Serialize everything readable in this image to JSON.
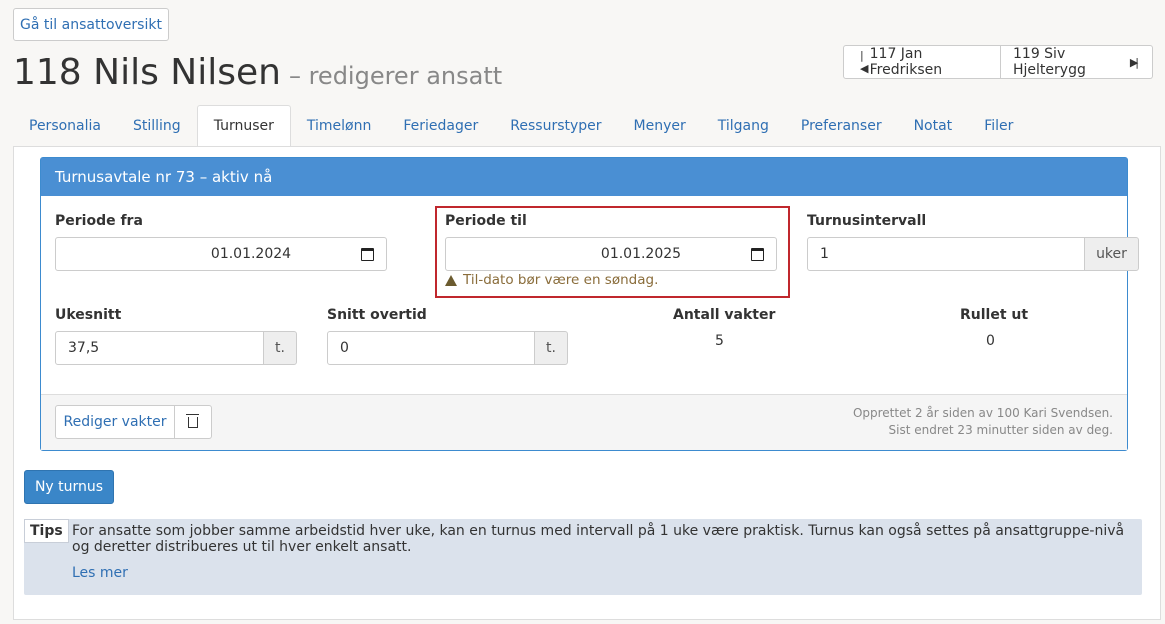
{
  "top_button": "Gå til ansattoversikt",
  "title": {
    "main": "118 Nils Nilsen",
    "sub": "– redigerer ansatt"
  },
  "nav": {
    "prev": "117 Jan Fredriksen",
    "next": "119 Siv Hjelterygg"
  },
  "tabs": [
    "Personalia",
    "Stilling",
    "Turnuser",
    "Timelønn",
    "Feriedager",
    "Ressurstyper",
    "Menyer",
    "Tilgang",
    "Preferanser",
    "Notat",
    "Filer"
  ],
  "active_tab": "Turnuser",
  "panel": {
    "heading": "Turnusavtale nr 73 – aktiv nå",
    "periode_fra": {
      "label": "Periode fra",
      "value": "01.01.2024"
    },
    "periode_til": {
      "label": "Periode til",
      "value": "01.01.2025",
      "warning": "Til-dato bør være en søndag."
    },
    "turnusintervall": {
      "label": "Turnusintervall",
      "value": "1",
      "unit": "uker"
    },
    "ukesnitt": {
      "label": "Ukesnitt",
      "value": "37,5",
      "unit": "t."
    },
    "snitt_overtid": {
      "label": "Snitt overtid",
      "value": "0",
      "unit": "t."
    },
    "antall_vakter": {
      "label": "Antall vakter",
      "value": "5"
    },
    "rullet_ut": {
      "label": "Rullet ut",
      "value": "0"
    },
    "edit_button": "Rediger vakter",
    "meta_created": "Opprettet 2 år siden av 100 Kari Svendsen.",
    "meta_updated": "Sist endret 23 minutter siden av deg."
  },
  "new_button": "Ny turnus",
  "tips": {
    "badge": "Tips",
    "text": "For ansatte som jobber samme arbeidstid hver uke, kan en turnus med intervall på 1 uke være praktisk. Turnus kan også settes på ansattgruppe-nivå og deretter distribueres ut til hver enkelt ansatt.",
    "link": "Les mer"
  }
}
